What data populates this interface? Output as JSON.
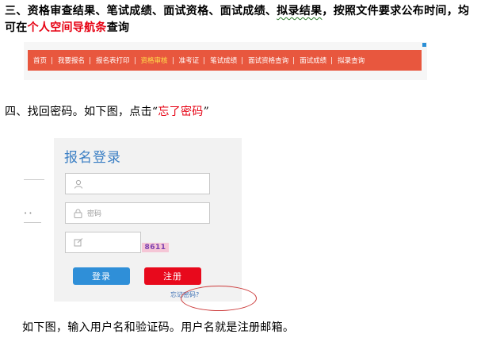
{
  "section3": {
    "text_a": "三、资格审查结果、笔试成绩、面试资格、面试成绩、",
    "text_b": "拟录结果",
    "text_c": "，按照文件要求公布时间，均可在",
    "text_red": "个人空间导航条",
    "text_d": "查询"
  },
  "navbar": {
    "items": [
      "首页",
      "我要报名",
      "报名表打印",
      "资格审核",
      "准考证",
      "笔试成绩",
      "面试资格查询",
      "面试成绩",
      "拟录查询"
    ],
    "active_index": 3
  },
  "section4": {
    "text_a": "四、找回密码。如下图，点击“",
    "text_red": "忘了密码",
    "text_b": "”"
  },
  "login": {
    "title": "报名登录",
    "password_placeholder": "密码",
    "captcha": "8611",
    "login_button": "登录",
    "register_button": "注册",
    "forgot_link": "忘记密码?"
  },
  "caption": "如下图，输入用户名和验证码。用户名就是注册邮箱。",
  "colors": {
    "accent_red": "#e60012",
    "navbar_bg": "#e8573e",
    "login_blue": "#2f8fd8",
    "register_red": "#e8091c"
  }
}
